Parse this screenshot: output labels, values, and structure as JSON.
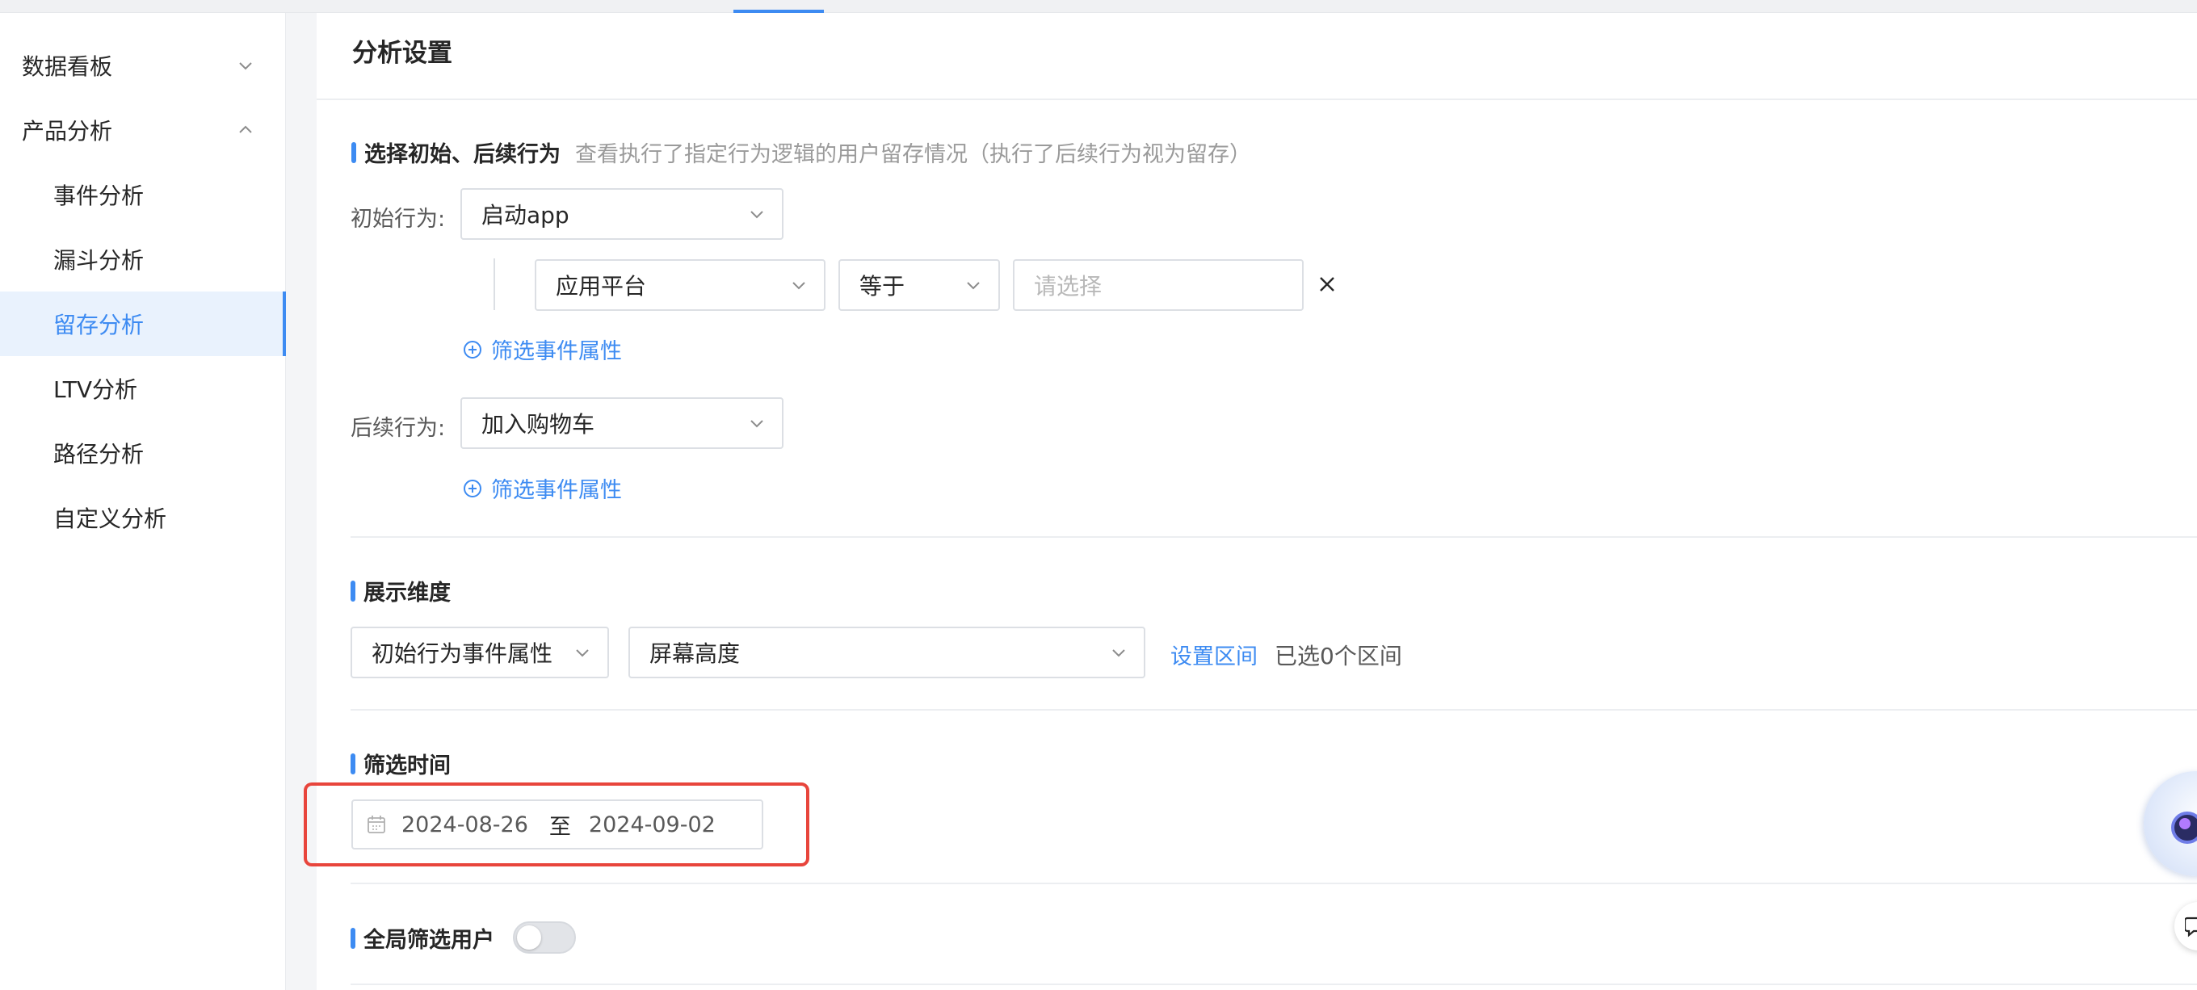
{
  "sidebar": {
    "items": [
      {
        "label": "数据看板",
        "level": "top",
        "expanded": false
      },
      {
        "label": "产品分析",
        "level": "top",
        "expanded": true
      },
      {
        "label": "事件分析",
        "level": "sub"
      },
      {
        "label": "漏斗分析",
        "level": "sub"
      },
      {
        "label": "留存分析",
        "level": "sub",
        "active": true
      },
      {
        "label": "LTV分析",
        "level": "sub"
      },
      {
        "label": "路径分析",
        "level": "sub"
      },
      {
        "label": "自定义分析",
        "level": "sub"
      }
    ]
  },
  "panel": {
    "title": "分析设置"
  },
  "behavior_section": {
    "title": "选择初始、后续行为",
    "description": "查看执行了指定行为逻辑的用户留存情况（执行了后续行为视为留存）",
    "initial_label": "初始行为:",
    "initial_value": "启动app",
    "filter": {
      "property": "应用平台",
      "operator": "等于",
      "value_placeholder": "请选择"
    },
    "add_filter_label": "筛选事件属性",
    "followup_label": "后续行为:",
    "followup_value": "加入购物车",
    "add_filter_label_2": "筛选事件属性"
  },
  "dimension_section": {
    "title": "展示维度",
    "dimension_type": "初始行为事件属性",
    "dimension_value": "屏幕高度",
    "set_range_label": "设置区间",
    "selected_count_text": "已选0个区间"
  },
  "time_section": {
    "title": "筛选时间",
    "start_date": "2024-08-26",
    "separator": "至",
    "end_date": "2024-09-02"
  },
  "global_filter_section": {
    "title": "全局筛选用户",
    "enabled": false
  },
  "colors": {
    "accent": "#3d8bf2",
    "highlight_border": "#e8453c",
    "active_bg": "#e9f2fd"
  }
}
